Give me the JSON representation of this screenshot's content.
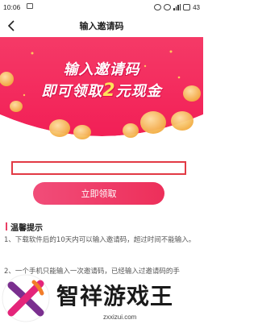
{
  "status_bar": {
    "time": "10:06",
    "battery": "43",
    "icons": [
      "image-notification-icon",
      "alarm-icon",
      "wifi-icon",
      "signal-icon",
      "battery-icon"
    ]
  },
  "nav": {
    "title": "输入邀请码",
    "back_icon": "chevron-left-icon"
  },
  "banner": {
    "line1": "输入邀请码",
    "line2_prefix": "即可领取",
    "line2_amount": "2",
    "line2_suffix": "元现金",
    "colors": {
      "background": "#f4245e",
      "highlight": "#ffe25a"
    }
  },
  "form": {
    "input_value": "",
    "input_placeholder": "",
    "button_label": "立即领取",
    "colors": {
      "border": "#e23a45",
      "button": "#ee3a64"
    }
  },
  "tips": {
    "title": "温馨提示",
    "items": [
      "1、下载软件后的10天内可以输入邀请码，超过时间不能输入。",
      "2、一个手机只能输入一次邀请码，已经输入过邀请码的手"
    ]
  },
  "watermark": {
    "name": "智祥游戏王",
    "url": "zxxizui.com"
  }
}
